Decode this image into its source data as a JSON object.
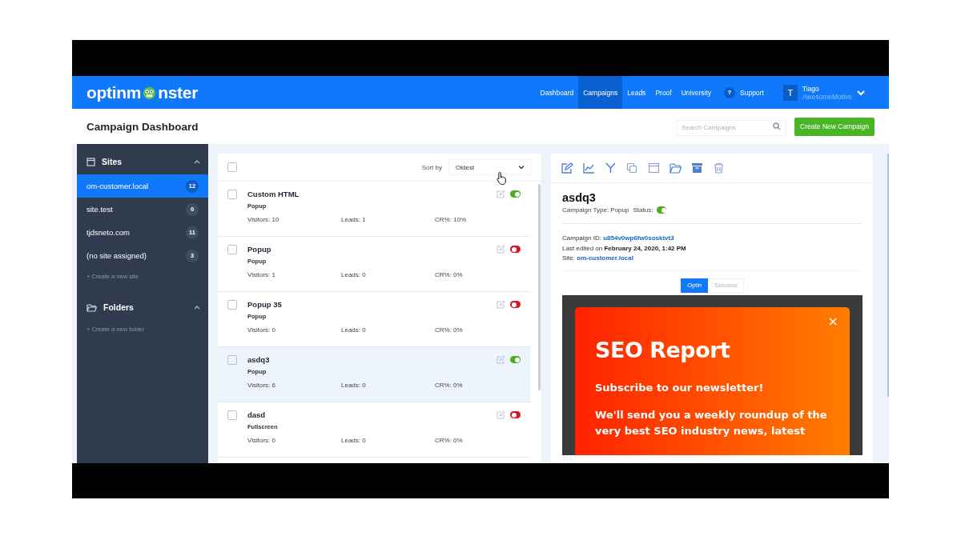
{
  "header": {
    "logo_parts": [
      "optinm",
      "nster"
    ],
    "nav": [
      {
        "label": "Dashboard",
        "selected": false
      },
      {
        "label": "Campaigns",
        "selected": true
      },
      {
        "label": "Leads",
        "selected": false
      },
      {
        "label": "Proof",
        "selected": false
      },
      {
        "label": "University",
        "selected": false
      }
    ],
    "support": {
      "icon": "?",
      "label": "Support"
    },
    "user": {
      "initial": "T",
      "name": "Tiago",
      "org": "AwesomeMotive"
    }
  },
  "page_title": "Campaign Dashboard",
  "search": {
    "placeholder": "Search Campaigns"
  },
  "create_button": "Create New Campaign",
  "sidebar": {
    "sites_title": "Sites",
    "sites": [
      {
        "name": "om-customer.local",
        "count": "12",
        "selected": true
      },
      {
        "name": "site.test",
        "count": "0",
        "selected": false
      },
      {
        "name": "tjdsneto.com",
        "count": "11",
        "selected": false
      },
      {
        "name": "(no site assigned)",
        "count": "3",
        "selected": false
      }
    ],
    "create_site": "+ Create a new site",
    "folders_title": "Folders",
    "create_folder": "+ Create a new folder"
  },
  "list": {
    "select_all_checked": false,
    "sort_label": "Sort by",
    "sort_value": "Oldest",
    "campaigns": [
      {
        "name": "Custom HTML",
        "type": "Popup",
        "visitors_label": "Visitors:",
        "visitors": "10",
        "leads_label": "Leads:",
        "leads": "1",
        "cr_label": "CR%:",
        "cr": "10%",
        "on": true,
        "checked": false,
        "selected": false
      },
      {
        "name": "Popup",
        "type": "Popup",
        "visitors_label": "Visitors:",
        "visitors": "1",
        "leads_label": "Leads:",
        "leads": "0",
        "cr_label": "CR%:",
        "cr": "0%",
        "on": false,
        "checked": false,
        "selected": false
      },
      {
        "name": "Popup 35",
        "type": "Popup",
        "visitors_label": "Visitors:",
        "visitors": "0",
        "leads_label": "Leads:",
        "leads": "0",
        "cr_label": "CR%:",
        "cr": "0%",
        "on": false,
        "checked": false,
        "selected": false
      },
      {
        "name": "asdq3",
        "type": "Popup",
        "visitors_label": "Visitors:",
        "visitors": "6",
        "leads_label": "Leads:",
        "leads": "0",
        "cr_label": "CR%:",
        "cr": "0%",
        "on": true,
        "checked": false,
        "selected": true
      },
      {
        "name": "dasd",
        "type": "Fullscreen",
        "visitors_label": "Visitors:",
        "visitors": "0",
        "leads_label": "Leads:",
        "leads": "0",
        "cr_label": "CR%:",
        "cr": "0%",
        "on": false,
        "checked": false,
        "selected": false
      }
    ]
  },
  "detail": {
    "title": "asdq3",
    "type_line": "Campaign Type: Popup",
    "status_label": "Status:",
    "status_on": true,
    "id_label": "Campaign ID:",
    "id_value": "u854v0wp6fw0sosktvt3",
    "edited_line": "Last edited on **February 24, 2020, 1:42 PM**",
    "site_label": "Site:",
    "site_value": "om-customer.local",
    "preview_tabs": [
      {
        "label": "Optin",
        "selected": true
      },
      {
        "label": "Success",
        "selected": false
      }
    ],
    "preview": {
      "close": "×",
      "heading": "SEO Report",
      "subheading": "Subscribe to our newsletter!",
      "body": "We'll send you a weekly roundup of the very best SEO industry news, latest"
    }
  }
}
